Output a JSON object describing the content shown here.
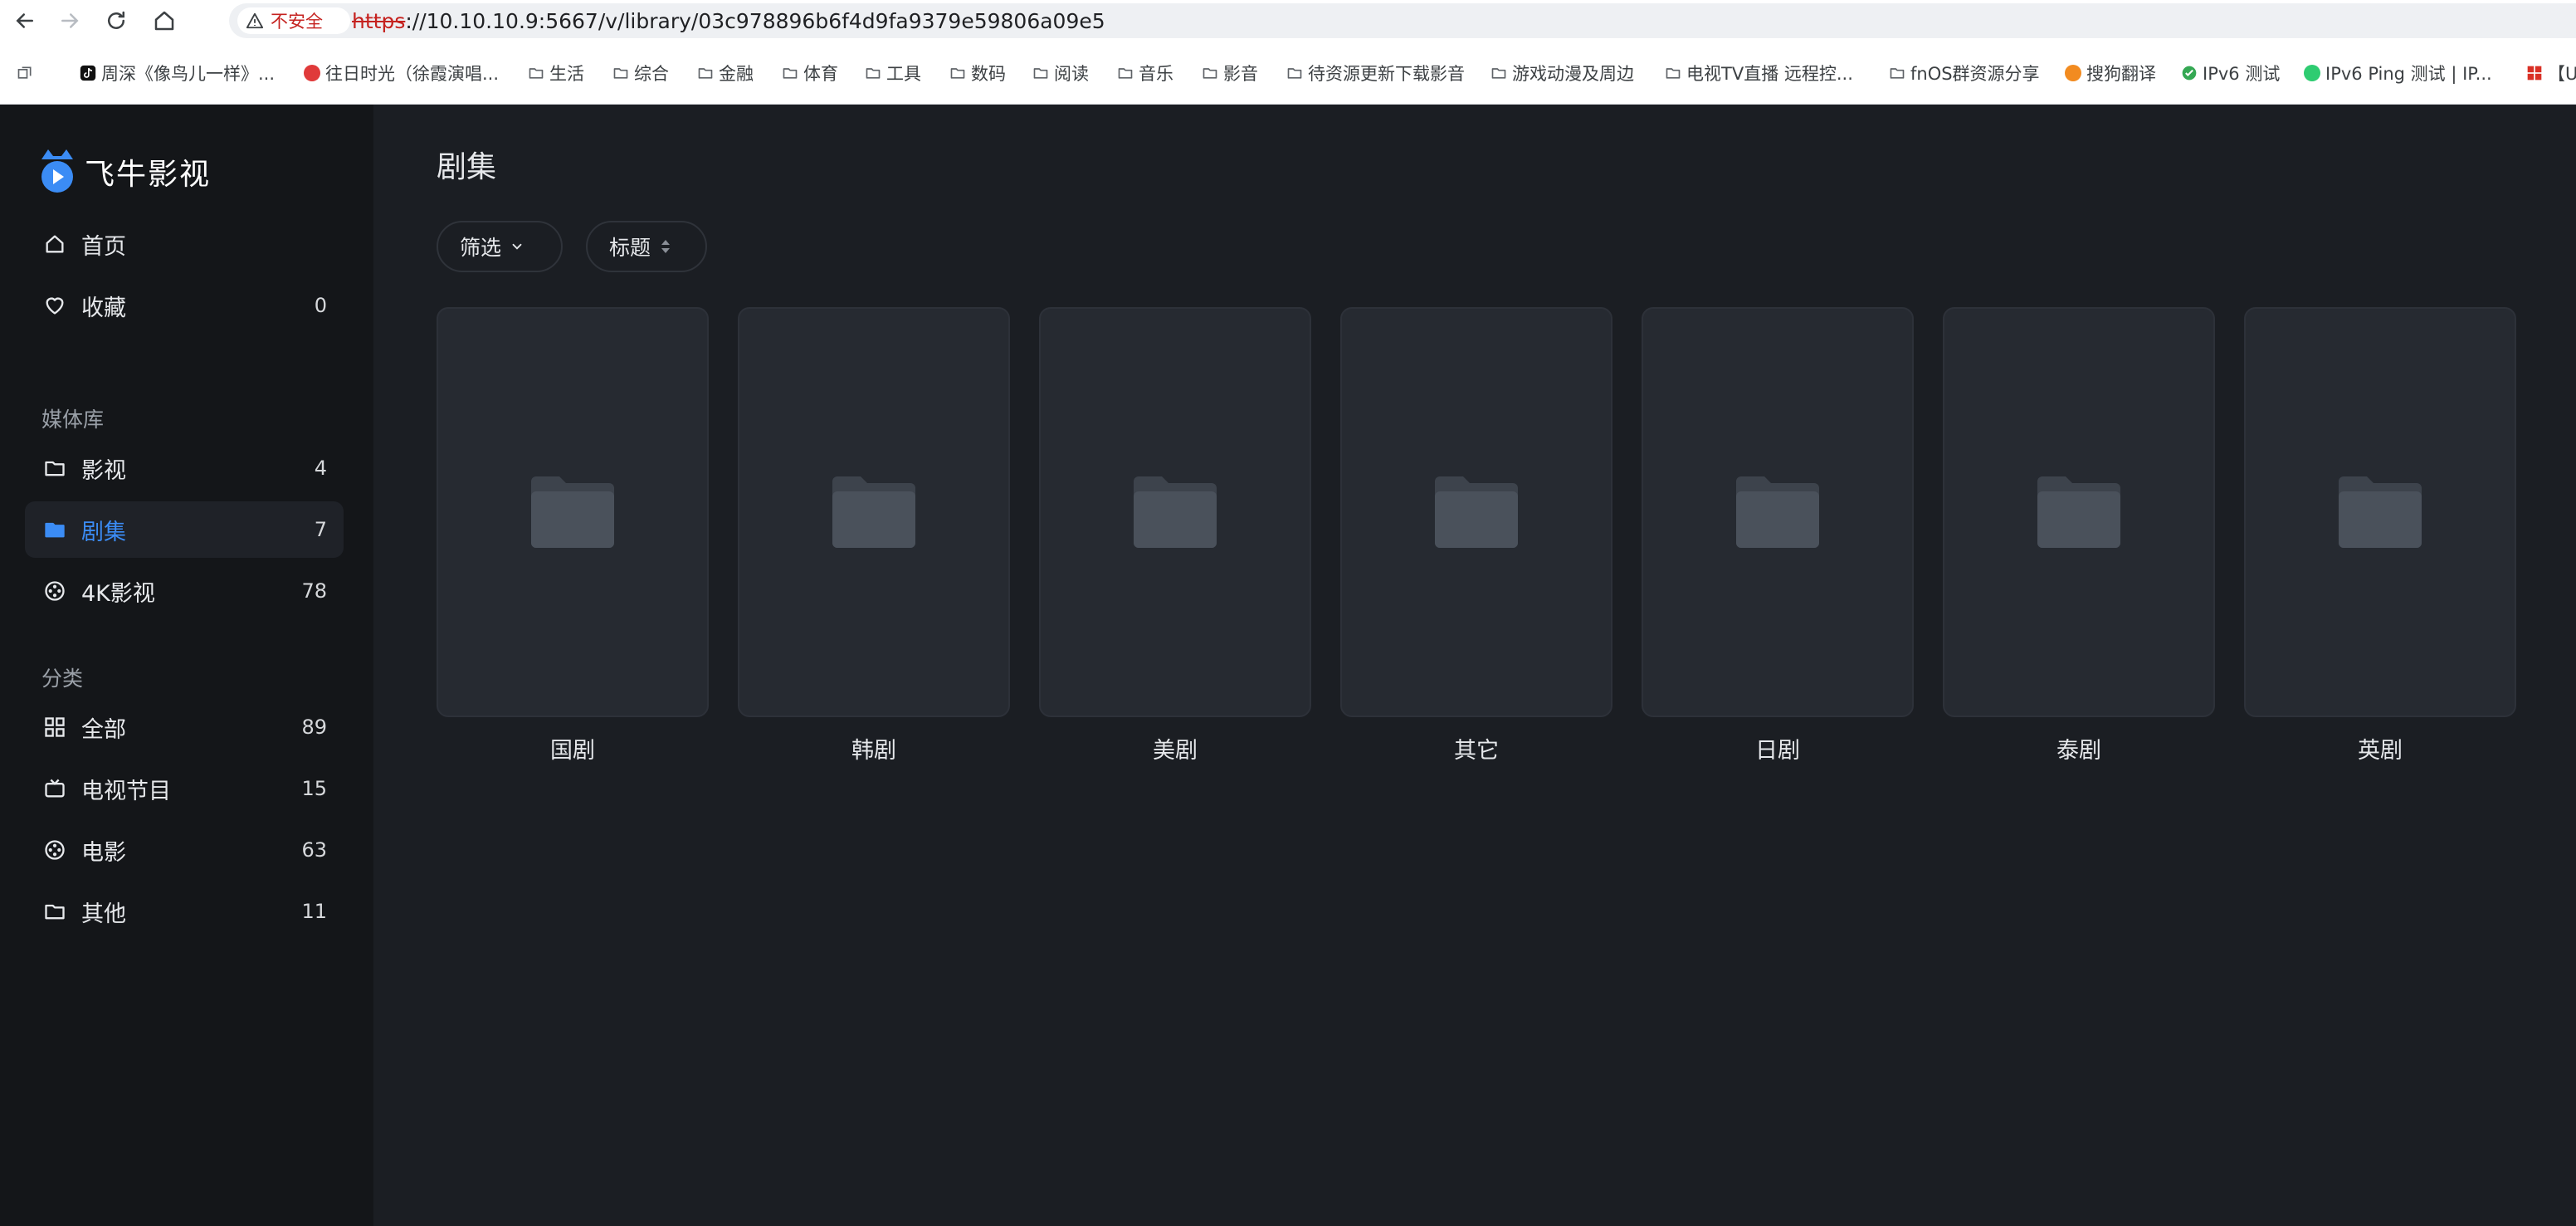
{
  "browser": {
    "security_label": "不安全",
    "url_scheme": "https",
    "url_rest": "://10.10.10.9:5667/v/library/03c978896b6f4d9fa9379e59806a09e5"
  },
  "bookmarks": [
    {
      "label": "周深《像鸟儿一样》...",
      "icon": "tiktok-icon"
    },
    {
      "label": "往日时光（徐霞演唱...",
      "icon": "bilibili-icon"
    },
    {
      "label": "生活",
      "icon": "folder-icon"
    },
    {
      "label": "综合",
      "icon": "folder-icon"
    },
    {
      "label": "金融",
      "icon": "folder-icon"
    },
    {
      "label": "体育",
      "icon": "folder-icon"
    },
    {
      "label": "工具",
      "icon": "folder-icon"
    },
    {
      "label": "数码",
      "icon": "folder-icon"
    },
    {
      "label": "阅读",
      "icon": "folder-icon"
    },
    {
      "label": "音乐",
      "icon": "folder-icon"
    },
    {
      "label": "影音",
      "icon": "folder-icon"
    },
    {
      "label": "待资源更新下载影音",
      "icon": "folder-icon"
    },
    {
      "label": "游戏动漫及周边",
      "icon": "folder-icon"
    },
    {
      "label": "电视TV直播 远程控...",
      "icon": "folder-icon"
    },
    {
      "label": "fnOS群资源分享",
      "icon": "folder-icon"
    },
    {
      "label": "搜狗翻译",
      "icon": "sogou-icon"
    },
    {
      "label": "IPv6 测试",
      "icon": "check-icon"
    },
    {
      "label": "IPv6 Ping 测试 | IP...",
      "icon": "ping-icon"
    },
    {
      "label": "【U",
      "icon": "grid-red-icon"
    }
  ],
  "sidebar": {
    "app_name": "飞牛影视",
    "top_items": [
      {
        "label": "首页",
        "count": "",
        "icon": "home-icon"
      },
      {
        "label": "收藏",
        "count": "0",
        "icon": "heart-icon"
      }
    ],
    "library_title": "媒体库",
    "library_items": [
      {
        "label": "影视",
        "count": "4",
        "icon": "folder-icon",
        "active": false
      },
      {
        "label": "剧集",
        "count": "7",
        "icon": "folder-filled-icon",
        "active": true
      },
      {
        "label": "4K影视",
        "count": "78",
        "icon": "film-reel-icon",
        "active": false
      }
    ],
    "category_title": "分类",
    "category_items": [
      {
        "label": "全部",
        "count": "89",
        "icon": "grid-icon"
      },
      {
        "label": "电视节目",
        "count": "15",
        "icon": "tv-icon"
      },
      {
        "label": "电影",
        "count": "63",
        "icon": "film-reel-icon"
      },
      {
        "label": "其他",
        "count": "11",
        "icon": "folder-icon"
      }
    ]
  },
  "main": {
    "title": "剧集",
    "filter_label": "筛选",
    "sort_label": "标题",
    "folders": [
      {
        "label": "国剧"
      },
      {
        "label": "韩剧"
      },
      {
        "label": "美剧"
      },
      {
        "label": "其它"
      },
      {
        "label": "日剧"
      },
      {
        "label": "泰剧"
      },
      {
        "label": "英剧"
      }
    ]
  },
  "colors": {
    "accent": "#3b8cf5",
    "sidebar_bg": "#141619",
    "main_bg": "#1b1e23",
    "card_bg": "#262a31",
    "insecure_red": "#c5221f"
  }
}
